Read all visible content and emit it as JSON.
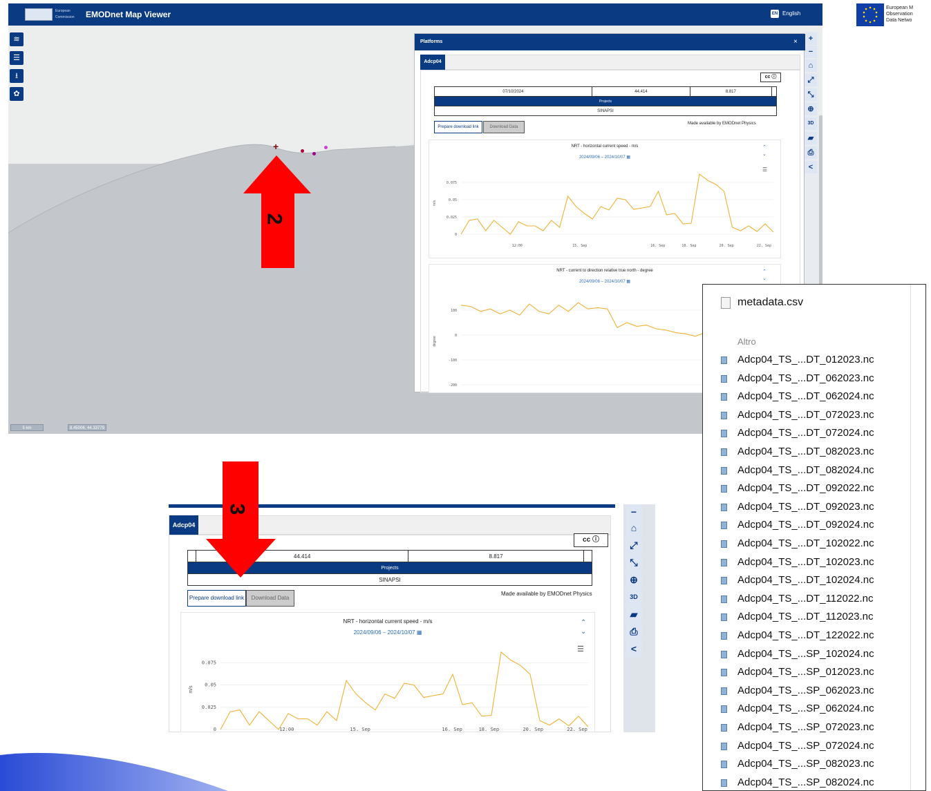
{
  "app": {
    "title": "EMODnet Map Viewer",
    "ec_text": "European Commission",
    "lang_code": "EN",
    "lang_label": "English"
  },
  "brand": {
    "line1": "European M",
    "line2": "Observation",
    "line3": "Data Netwo"
  },
  "map": {
    "scale_label": "5 km",
    "coords": "8.45006, 44.33779",
    "left_buttons": [
      "layers-icon",
      "list-icon",
      "download-icon",
      "settings-icon"
    ],
    "right_buttons": [
      "+",
      "−",
      "⌂",
      "⤢",
      "⤡",
      "⊕",
      "3D",
      "📏",
      "🖶",
      "<"
    ]
  },
  "panel": {
    "title": "Platforms",
    "close": "×",
    "tab": "Adcp04",
    "date": "07/10/2024",
    "lat": "44.414",
    "lon": "8.817",
    "projects_header": "Projects",
    "project": "SINAPSI",
    "prepare_btn": "Prepare download link",
    "download_btn": "Download Data",
    "made_by": "Made available by EMODnet Physics"
  },
  "charts": [
    {
      "title": "NRT - horizontal current speed - m/s",
      "date_from": "2024/09/06",
      "date_sep": "–",
      "date_to": "2024/10/07",
      "ylabel": "m/s",
      "yticks": [
        "0.075",
        "0.05",
        "0.025",
        "0"
      ],
      "xticks": [
        "12:00",
        "15. Sep",
        "16. Sep",
        "18. Sep",
        "20. Sep",
        "22. Sep"
      ]
    },
    {
      "title": "NRT - current to direction relative true north - degree",
      "date_from": "2024/09/06",
      "date_sep": "–",
      "date_to": "2024/10/07",
      "ylabel": "degree",
      "yticks": [
        "100",
        "0",
        "-100",
        "-200"
      ]
    }
  ],
  "chart_data": [
    {
      "type": "line",
      "title": "NRT - horizontal current speed - m/s",
      "ylabel": "m/s",
      "ylim": [
        0,
        0.09
      ],
      "xticks": [
        "12:00",
        "15. Sep",
        "16. Sep",
        "18. Sep",
        "20. Sep",
        "22. Sep"
      ],
      "series": [
        {
          "values": [
            0.0,
            0.02,
            0.022,
            0.005,
            0.02,
            0.01,
            0.0,
            0.018,
            0.012,
            0.012,
            0.005,
            0.02,
            0.01,
            0.055,
            0.04,
            0.03,
            0.022,
            0.04,
            0.035,
            0.052,
            0.05,
            0.036,
            0.038,
            0.04,
            0.062,
            0.028,
            0.03,
            0.015,
            0.016,
            0.087,
            0.078,
            0.072,
            0.062,
            0.01,
            0.005,
            0.012,
            0.004,
            0.015,
            0.003
          ]
        }
      ]
    },
    {
      "type": "line",
      "title": "NRT - current to direction relative true north - degree",
      "ylabel": "degree",
      "ylim": [
        -200,
        150
      ],
      "series": [
        {
          "values": [
            120,
            115,
            95,
            105,
            85,
            100,
            80,
            125,
            95,
            85,
            120,
            95,
            130,
            105,
            110,
            105,
            30,
            50,
            35,
            40,
            25,
            20,
            10,
            5,
            -5,
            10,
            20,
            5,
            -20,
            -40,
            -80,
            -90,
            -70
          ]
        }
      ]
    }
  ],
  "arrows": {
    "a2": "2",
    "a3": "3"
  },
  "files": {
    "top": "metadata.csv",
    "section": "Altro",
    "items": [
      "Adcp04_TS_...DT_012023.nc",
      "Adcp04_TS_...DT_062023.nc",
      "Adcp04_TS_...DT_062024.nc",
      "Adcp04_TS_...DT_072023.nc",
      "Adcp04_TS_...DT_072024.nc",
      "Adcp04_TS_...DT_082023.nc",
      "Adcp04_TS_...DT_082024.nc",
      "Adcp04_TS_...DT_092022.nc",
      "Adcp04_TS_...DT_092023.nc",
      "Adcp04_TS_...DT_092024.nc",
      "Adcp04_TS_...DT_102022.nc",
      "Adcp04_TS_...DT_102023.nc",
      "Adcp04_TS_...DT_102024.nc",
      "Adcp04_TS_...DT_112022.nc",
      "Adcp04_TS_...DT_112023.nc",
      "Adcp04_TS_...DT_122022.nc",
      "Adcp04_TS_...SP_102024.nc",
      "Adcp04_TS_...SP_012023.nc",
      "Adcp04_TS_...SP_062023.nc",
      "Adcp04_TS_...SP_062024.nc",
      "Adcp04_TS_...SP_072023.nc",
      "Adcp04_TS_...SP_072024.nc",
      "Adcp04_TS_...SP_082023.nc",
      "Adcp04_TS_...SP_082024.nc"
    ]
  },
  "colors": {
    "brand": "#0a3a82",
    "line": "#f2b134",
    "arrow": "#ff0000"
  }
}
